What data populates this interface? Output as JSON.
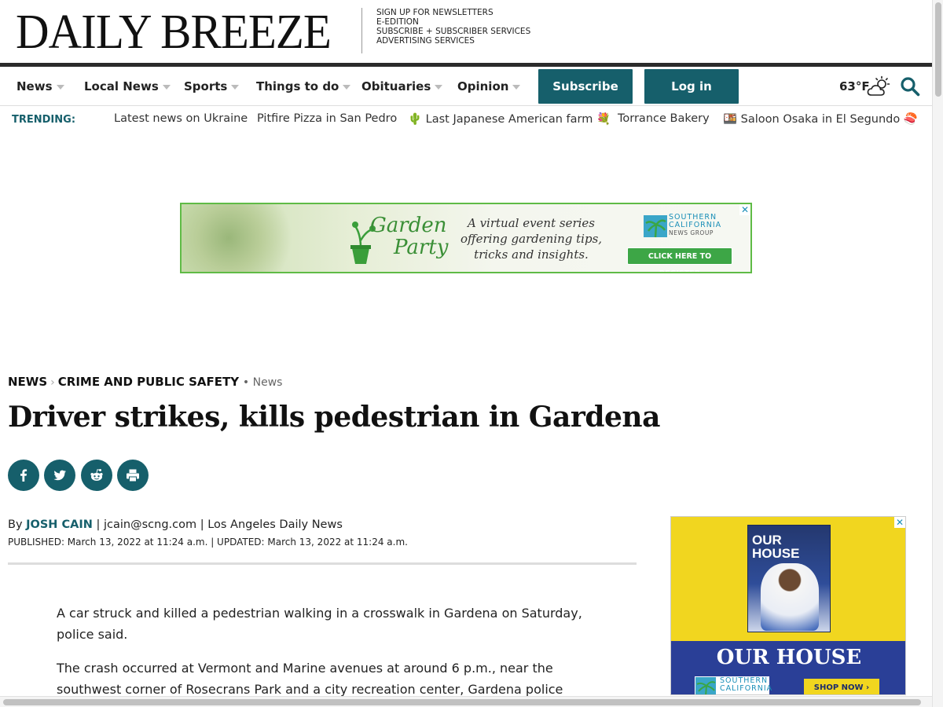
{
  "masthead": {
    "logo": "DAILY BREEZE",
    "links": [
      "SIGN UP FOR NEWSLETTERS",
      "E-EDITION",
      "SUBSCRIBE + SUBSCRIBER SERVICES",
      "ADVERTISING SERVICES"
    ]
  },
  "nav": {
    "items": [
      "News",
      "Local News",
      "Sports",
      "Things to do",
      "Obituaries",
      "Opinion"
    ],
    "subscribe": "Subscribe",
    "login": "Log in",
    "temperature": "63°F"
  },
  "trending": {
    "label": "TRENDING:",
    "items": [
      "Latest news on Ukraine",
      "Pitfire Pizza in San Pedro",
      "🌵 Last Japanese American farm 💐",
      "Torrance Bakery",
      "🍱 Saloon Osaka in El Segundo 🍣"
    ]
  },
  "ad_banner": {
    "brand_1": "Garden",
    "brand_2": "Party",
    "tagline": "A virtual event series offering gardening tips, tricks and insights.",
    "sponsor_1": "SOUTHERN",
    "sponsor_2": "CALIFORNIA",
    "sponsor_3": "NEWS GROUP",
    "cta": "CLICK HERE TO REGISTER",
    "close": "✕"
  },
  "article": {
    "breadcrumb": [
      "NEWS",
      "CRIME AND PUBLIC SAFETY"
    ],
    "tag": "News",
    "headline": "Driver strikes, kills pedestrian in Gardena",
    "byline_prefix": "By",
    "author": "JOSH CAIN",
    "byline_rest": "| jcain@scng.com | Los Angeles Daily News",
    "dates": "PUBLISHED: March 13, 2022 at 11:24 a.m. | UPDATED: March 13, 2022 at 11:24 a.m.",
    "paragraphs": [
      "A car struck and killed a pedestrian walking in a crosswalk in Gardena on Saturday, police said.",
      "The crash occurred at Vermont and Marine avenues at around 6 p.m., near the southwest corner of Rosecrans Park and a city recreation center, Gardena police said in a statement."
    ]
  },
  "ad_side": {
    "mag_title": "OUR HOUSE",
    "title": "OUR HOUSE",
    "sponsor_1": "SOUTHERN",
    "sponsor_2": "CALIFORNIA",
    "cta": "SHOP NOW ›",
    "close": "✕"
  },
  "colors": {
    "brand_teal": "#165f6b",
    "ad_green": "#5fbb46",
    "ad_yellow": "#f1d61f",
    "ad_navy": "#2a3f97"
  }
}
